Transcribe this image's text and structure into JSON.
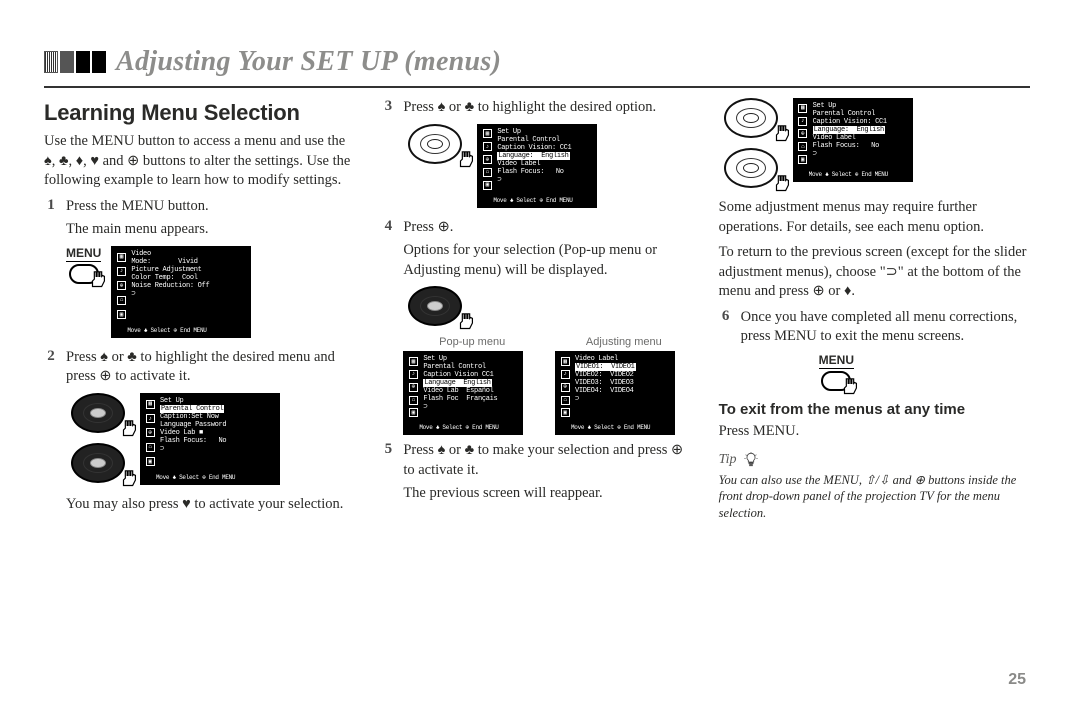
{
  "chapter_title": "Adjusting Your SET UP (menus)",
  "page_number": "25",
  "section_heading": "Learning Menu Selection",
  "intro": "Use the MENU button to access a menu and use the ♠, ♣, ♦, ♥ and ⊕ buttons to alter the settings. Use the following example to learn how to modify settings.",
  "steps": {
    "s1": {
      "n": "1",
      "text": "Press the MENU button.",
      "sub": "The main menu appears."
    },
    "s2": {
      "n": "2",
      "text": "Press ♠ or ♣ to highlight the desired menu and press ⊕ to activate it.",
      "after": "You may also press ♥ to activate your selection."
    },
    "s3": {
      "n": "3",
      "text": "Press ♠ or ♣ to highlight the desired option."
    },
    "s4": {
      "n": "4",
      "text": "Press ⊕.",
      "after": "Options for your selection (Pop-up menu or Adjusting menu) will be displayed."
    },
    "s5": {
      "n": "5",
      "text": "Press ♠ or ♣ to make your selection and press ⊕ to activate it.",
      "after": "The previous screen will reappear."
    },
    "s6_intro": "Some adjustment menus may require further operations. For details, see each menu option.",
    "s6_return": "To return to the previous screen (except for the slider adjustment menus), choose \"⊃\" at the bottom of the menu and press ⊕ or ♦.",
    "s6": {
      "n": "6",
      "text": "Once you have completed all menu corrections, press MENU to exit the menu screens."
    }
  },
  "labels": {
    "menu": "MENU",
    "popup": "Pop-up menu",
    "adjusting": "Adjusting menu"
  },
  "screens": {
    "main": {
      "title": "Video",
      "lines": [
        "Mode:       Vivid",
        "Picture Adjustment",
        "Color Temp:  Cool",
        "Noise Reduction: Off",
        "⊃"
      ],
      "footer": "Move ♣  Select ⊕  End MENU"
    },
    "setup1": {
      "title": "Set Up",
      "lines": [
        "Parental Control",
        "Caption:Set Now",
        "Language Password",
        "Video Lab ■",
        "Flash Focus:   No",
        "⊃"
      ],
      "hl": 0,
      "footer": "Move ♣  Select ⊕  End MENU"
    },
    "setup2": {
      "title": "Set Up",
      "lines": [
        "Parental Control",
        "Caption Vision: CC1",
        "Language:  English",
        "Video Label",
        "Flash Focus:   No",
        "⊃"
      ],
      "hl": 2,
      "footer": "Move ♣  Select ⊕  End MENU"
    },
    "popup": {
      "title": "Set Up",
      "lines": [
        "Parental Control",
        "Caption Vision CC1",
        "Language  English",
        "Video Lab  Español",
        "Flash Foc  Français",
        "⊃"
      ],
      "hl": 2,
      "footer": "Move ♣  Select ⊕  End MENU"
    },
    "adjusting": {
      "title": "Video Label",
      "lines": [
        "VIDEO1:  VIDEO1",
        "VIDEO2:  VIDEO2",
        "VIDEO3:  VIDEO3",
        "VIDEO4:  VIDEO4",
        "⊃"
      ],
      "hl": 0,
      "footer": "Move ♣  Select ⊕  End MENU"
    },
    "setup3": {
      "title": "Set Up",
      "lines": [
        "Parental Control",
        "Caption Vision: CC1",
        "Language:  English",
        "Video Label",
        "Flash Focus:   No",
        "⊃"
      ],
      "hl": 2,
      "footer": "Move ♣  Select ⊕  End MENU"
    }
  },
  "exit": {
    "heading": "To exit from the menus at any time",
    "body": "Press MENU."
  },
  "tip": {
    "label": "Tip",
    "text": "You can also use the MENU, ⇧/⇩ and ⊕ buttons inside the front drop-down panel of the projection TV for the menu selection."
  }
}
